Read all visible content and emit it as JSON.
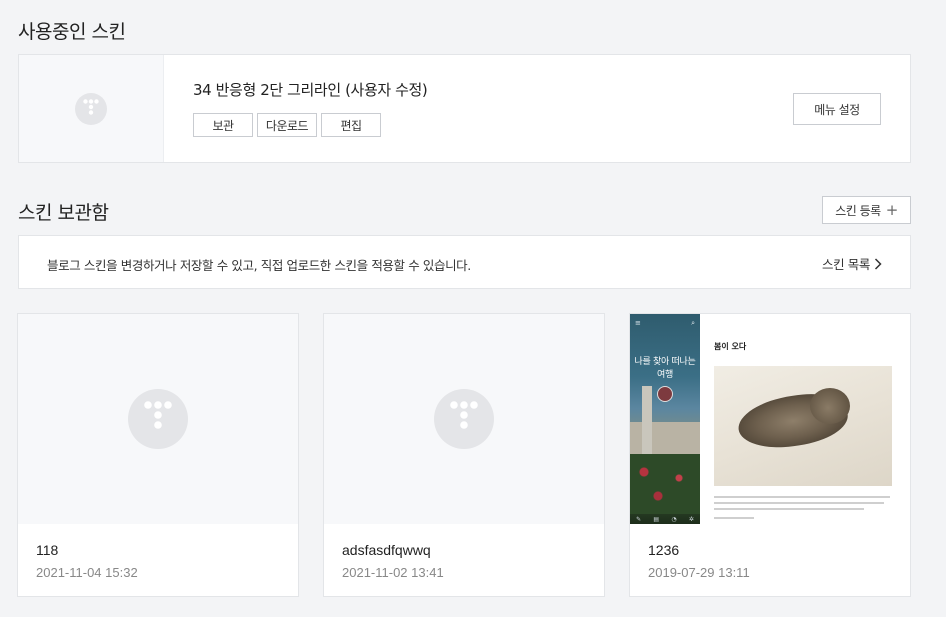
{
  "current_section": {
    "title": "사용중인 스킨",
    "skin_name": "34 반응형 2단 그리라인 (사용자 수정)",
    "buttons": [
      "보관",
      "다운로드",
      "편집"
    ],
    "menu_button": "메뉴 설정"
  },
  "storage_section": {
    "title": "스킨 보관함",
    "register_button": "스킨 등록",
    "register_icon": "plus-icon",
    "info_text": "블로그 스킨을 변경하거나 저장할 수 있고, 직접 업로드한 스킨을 적용할 수 있습니다.",
    "list_link": "스킨 목록"
  },
  "skins": [
    {
      "name": "118",
      "date": "2021-11-04 15:32",
      "thumb": "tistory-logo-icon"
    },
    {
      "name": "adsfasdfqwwq",
      "date": "2021-11-02 13:41",
      "thumb": "tistory-logo-icon"
    },
    {
      "name": "1236",
      "date": "2019-07-29 13:11",
      "thumb": "preview-image"
    }
  ],
  "preview": {
    "sidebar_title": "나를 찾아 떠나는 여행",
    "post_title": "봄이 오다"
  },
  "colors": {
    "background": "#f3f4f6",
    "card": "#ffffff",
    "border": "#e3e5e8",
    "logo_gray": "#e4e5e8"
  }
}
